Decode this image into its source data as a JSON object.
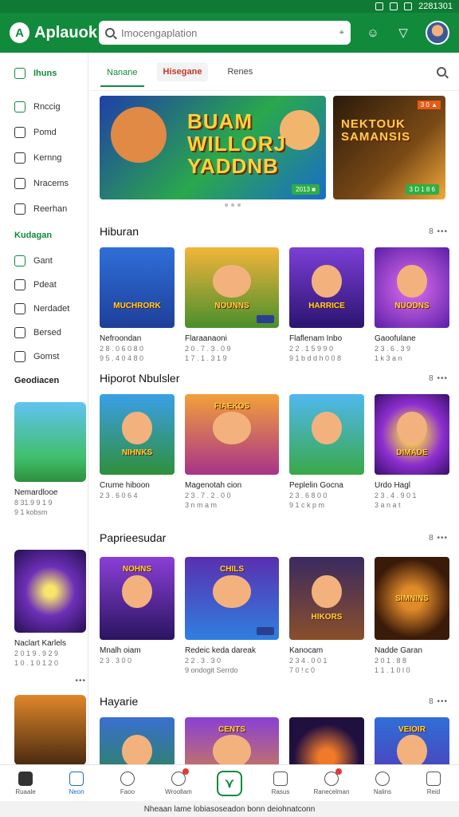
{
  "status": {
    "time": "2281301"
  },
  "topbar": {
    "app_name": "Aplauok",
    "search_placeholder": "Imocengaplation",
    "mic": "⌖"
  },
  "sidebar": {
    "primary": {
      "label": "Ihuns"
    },
    "items": [
      {
        "label": "Rnccig"
      },
      {
        "label": "Pomd"
      },
      {
        "label": "Kernng"
      },
      {
        "label": "Nracems"
      },
      {
        "label": "Reerhan"
      }
    ],
    "section_title": "Kudagan",
    "section_items": [
      {
        "label": "Gant"
      },
      {
        "label": "Pdeat"
      },
      {
        "label": "Nerdadet"
      },
      {
        "label": "Bersed"
      },
      {
        "label": "Gomst"
      }
    ],
    "section2_title": "Geodiacen",
    "cards": [
      {
        "title": "Nemardlooe",
        "meta1": "8 31.9 9 1 9",
        "meta2": "9 1 kobsm"
      },
      {
        "title": "Naclart Karlels",
        "meta1": "2 0 1 9 . 9 2 9",
        "meta2": "1 0 . 1 0 1 2 0"
      }
    ]
  },
  "tabs": [
    {
      "label": "Nanane"
    },
    {
      "label": "Hisegane"
    },
    {
      "label": "Renes"
    }
  ],
  "banners": {
    "b1_text": "BUAM WILLORJ YADDNB",
    "b1_tag": "2013 ■",
    "b2_text": "NEKTOUK SAMANSIS",
    "b2_tag_top": "3 0 ▲",
    "b2_tag": "3 D 1 8 6"
  },
  "sections": [
    {
      "title": "Hiburan",
      "more": "8 •••",
      "cards": [
        {
          "title": "Nefroondan",
          "meta1": "2 8 . 0 6 0 8 0",
          "meta2": "9 5 . 4 0 4 8 0",
          "art": "MUCHRORK"
        },
        {
          "title": "Flaraanaoni",
          "meta1": "2 0 . 7 . 3 . 0 9",
          "meta2": "1 7 . 1 . 3 1 9",
          "art": "NOUNNS"
        },
        {
          "title": "Flaflenam Inbo",
          "meta1": "2 2 . 1 5 9 9 0",
          "meta2": "9 1 b d d h 0 0 8",
          "art": "HARRICE"
        },
        {
          "title": "Gaoofulane",
          "meta1": "2 3 . 6 . 3 9",
          "meta2": "1 k 3 a n",
          "art": "NUODNS"
        }
      ]
    },
    {
      "title": "Hiporot Nbulsler",
      "more": "8 •••",
      "cards": [
        {
          "title": "Crume hiboon",
          "meta1": "2 3 . 6 0 6 4",
          "meta2": "",
          "art": "NIHNKS"
        },
        {
          "title": "Magenotah cion",
          "meta1": "2 3 . 7 . 2 . 0 0",
          "meta2": "3 n m a m",
          "art": "FIAEKOS"
        },
        {
          "title": "Peplelin Gocna",
          "meta1": "2 3 . 6 8 0 0",
          "meta2": "9 1 c k p m",
          "art": ""
        },
        {
          "title": "Urdo Hagl",
          "meta1": "2 3 . 4 . 9 0 1",
          "meta2": "3 a n a t",
          "art": "DIMADE"
        }
      ]
    },
    {
      "title": "Paprieesudar",
      "more": "8 •••",
      "cards": [
        {
          "title": "Mnalh oiam",
          "meta1": "2 3 . 3 0 0",
          "meta2": "",
          "art": "NOHNS"
        },
        {
          "title": "Redeic keda dareak",
          "meta1": "2 2 . 3 . 3 0",
          "meta2": "9 ondogit Serrdo",
          "art": "CHILS"
        },
        {
          "title": "Kanocam",
          "meta1": "2 3 4 . 0 0 1",
          "meta2": "7 0 ! c 0",
          "art": "HIKORS"
        },
        {
          "title": "Nadde Garan",
          "meta1": "2 0 1 . 8 8",
          "meta2": "1 1 . 1 0 l 0",
          "art": "SIMNINS"
        }
      ]
    },
    {
      "title": "Hayarie",
      "more": "8 •••",
      "left_more": "•••",
      "cards": [
        {
          "title": "",
          "meta1": "",
          "meta2": "",
          "art": ""
        },
        {
          "title": "",
          "meta1": "",
          "meta2": "",
          "art": "CENTS"
        },
        {
          "title": "",
          "meta1": "",
          "meta2": "",
          "art": ""
        },
        {
          "title": "",
          "meta1": "",
          "meta2": "",
          "art": "VEIOIR"
        }
      ]
    }
  ],
  "bottomnav": [
    {
      "label": "Ruaale"
    },
    {
      "label": "Neon"
    },
    {
      "label": "Faoo"
    },
    {
      "label": "Wroollam"
    },
    {
      "label": ""
    },
    {
      "label": "Rasus"
    },
    {
      "label": "Ranecelman"
    },
    {
      "label": "Nalins"
    },
    {
      "label": "Reid"
    }
  ],
  "footer": "Nheaan lame lobiasoseadon bonn deiohnatconn",
  "colors": {
    "brand": "#128a3c",
    "active_blue": "#1b6cc9",
    "badge": "#e53935"
  }
}
